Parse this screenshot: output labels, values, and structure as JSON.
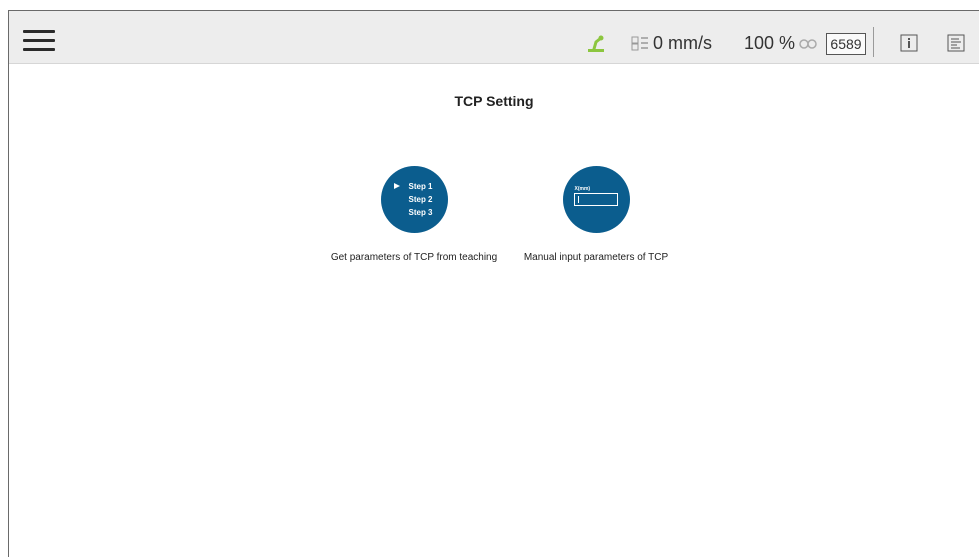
{
  "header": {
    "menu_icon": "hamburger-menu-icon",
    "robot_icon": "robot-arm-icon",
    "speed_icon": "speed-icon",
    "speed": "0 mm/s",
    "speed_percent": "100 %",
    "percent_icon": "link-icon",
    "counter": "6589",
    "info_icon": "info-icon",
    "log_icon": "log-icon",
    "robot_icon_color": "#8cc63f"
  },
  "page": {
    "title": "TCP Setting"
  },
  "options": [
    {
      "label": "Get parameters of TCP from teaching",
      "steps": [
        "Step 1",
        "Step 2",
        "Step 3"
      ]
    },
    {
      "label": "Manual input parameters of TCP",
      "field_label": "X(mm)"
    }
  ],
  "colors": {
    "accent": "#0b5d8e",
    "topbar": "#ededed"
  }
}
